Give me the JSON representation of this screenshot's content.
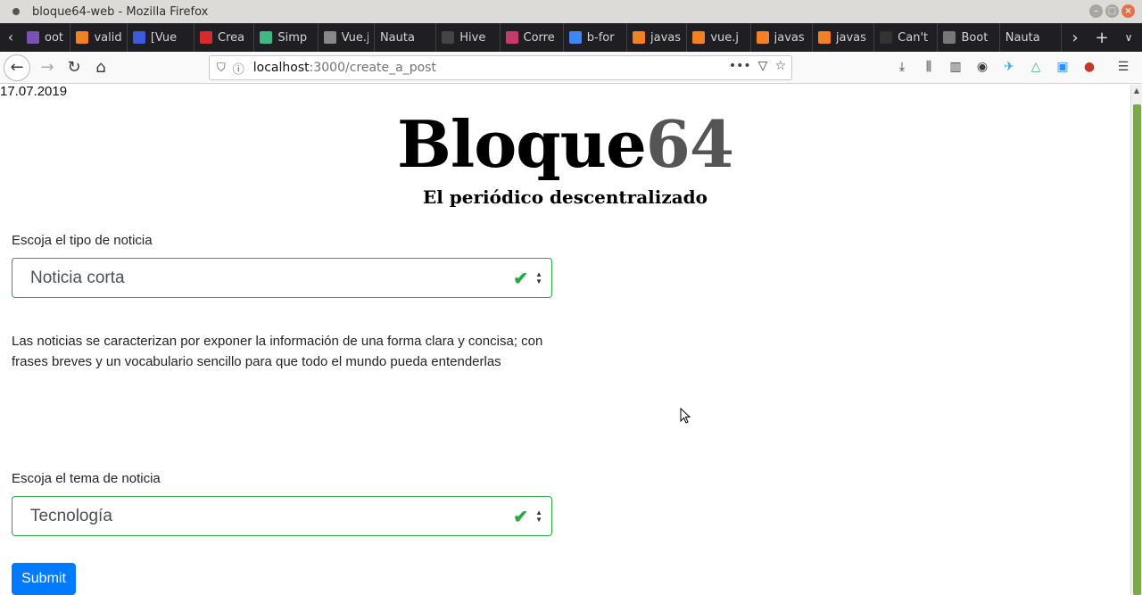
{
  "window": {
    "title": "bloque64-web - Mozilla Firefox"
  },
  "tabs": [
    {
      "label": "oot",
      "icon": "bootstrap-icon",
      "color": "#7952b3"
    },
    {
      "label": "valid",
      "icon": "stackoverflow-icon",
      "color": "#f48024"
    },
    {
      "label": "[Vue",
      "icon": "mdn-icon",
      "color": "#3b5bdb"
    },
    {
      "label": "Crea",
      "icon": "red-circle-icon",
      "color": "#d62c2c"
    },
    {
      "label": "Simp",
      "icon": "vue-icon",
      "color": "#41b883"
    },
    {
      "label": "Vue.j",
      "icon": "avatar-icon",
      "color": "#888888"
    },
    {
      "label": "Nauta",
      "icon": "",
      "color": ""
    },
    {
      "label": "Hive",
      "icon": "hive-icon",
      "color": "#444444"
    },
    {
      "label": "Corre",
      "icon": "link-icon",
      "color": "#c83a6b"
    },
    {
      "label": "b-for",
      "icon": "google-icon",
      "color": "#4285f4"
    },
    {
      "label": "javas",
      "icon": "stackoverflow-icon",
      "color": "#f48024"
    },
    {
      "label": "vue.j",
      "icon": "stackoverflow-icon",
      "color": "#f48024"
    },
    {
      "label": "javas",
      "icon": "stackoverflow-icon",
      "color": "#f48024"
    },
    {
      "label": "javas",
      "icon": "stackoverflow-icon",
      "color": "#f48024"
    },
    {
      "label": "Can't",
      "icon": "github-icon",
      "color": "#333333"
    },
    {
      "label": "Boot",
      "icon": "box-icon",
      "color": "#777777"
    },
    {
      "label": "Nauta",
      "icon": "",
      "color": ""
    }
  ],
  "urlbar": {
    "host": "localhost",
    "path": ":3000/create_a_post"
  },
  "page": {
    "date": "17.07.2019",
    "logo_text": "Bloque",
    "logo_num": "64",
    "subtitle": "El periódico descentralizado",
    "type_label": "Escoja el tipo de noticia",
    "type_value": "Noticia corta",
    "description": "Las noticias se caracterizan por exponer la  información de una forma clara y concisa; con frases breves y un vocabulario sencillo para que todo el mundo pueda entenderlas",
    "topic_label": "Escoja el tema de noticia",
    "topic_value": "Tecnología",
    "submit_label": "Submit"
  },
  "colors": {
    "valid_green": "#28a745",
    "primary_blue": "#007bff"
  }
}
